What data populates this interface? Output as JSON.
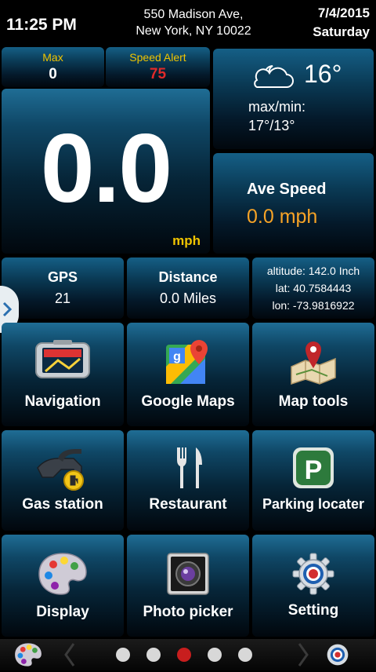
{
  "header": {
    "time": "11:25 PM",
    "address_line1": "550 Madison Ave,",
    "address_line2": "New York, NY 10022",
    "date": "7/4/2015",
    "weekday": "Saturday"
  },
  "stats": {
    "max_label": "Max",
    "max_value": "0",
    "speed_alert_label": "Speed Alert",
    "speed_alert_value": "75",
    "speed_value": "0.0",
    "speed_unit": "mph"
  },
  "weather": {
    "icon": "partly-cloudy-night-icon",
    "temp": "16°",
    "maxmin_label": "max/min:",
    "maxmin_value": "17°/13°"
  },
  "ave_speed": {
    "label": "Ave Speed",
    "value": "0.0 mph"
  },
  "gps": {
    "label": "GPS",
    "value": "21"
  },
  "distance": {
    "label": "Distance",
    "value": "0.0 Miles"
  },
  "location": {
    "altitude": "altitude: 142.0 Inch",
    "lat": "lat: 40.7584443",
    "lon": "lon: -73.9816922"
  },
  "apps": [
    {
      "label": "Navigation",
      "icon": "gps-device-icon"
    },
    {
      "label": "Google Maps",
      "icon": "google-maps-icon"
    },
    {
      "label": "Map tools",
      "icon": "map-pin-icon"
    },
    {
      "label": "Gas station",
      "icon": "fuel-nozzle-icon"
    },
    {
      "label": "Restaurant",
      "icon": "fork-knife-icon"
    },
    {
      "label": "Parking locater",
      "icon": "parking-icon"
    },
    {
      "label": "Display",
      "icon": "palette-icon"
    },
    {
      "label": "Photo picker",
      "icon": "camera-icon"
    },
    {
      "label": "Setting",
      "icon": "gear-icon"
    }
  ],
  "pager": {
    "pages": 5,
    "active_index": 2
  },
  "colors": {
    "accent_yellow": "#f0c400",
    "alert_red": "#e02a2a",
    "orange": "#f7a326",
    "tile_blue": "#0f4766"
  }
}
